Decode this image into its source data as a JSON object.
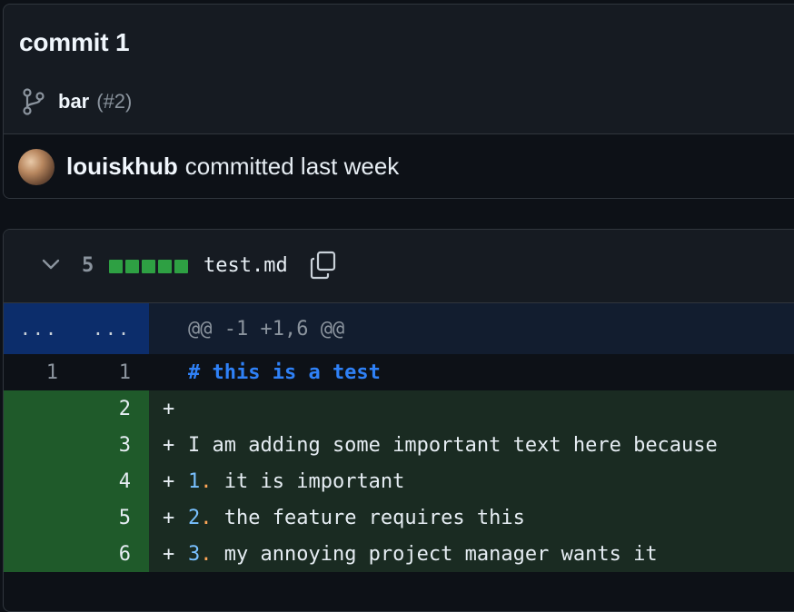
{
  "commit": {
    "title": "commit 1",
    "branch": "bar",
    "pr": "(#2)",
    "author": "louiskhub",
    "meta": "committed last week"
  },
  "file": {
    "changes": "5",
    "diffstat_additions": 5,
    "name": "test.md"
  },
  "diff": {
    "hunk": {
      "old": "...",
      "new": "...",
      "header": "@@ -1 +1,6 @@"
    },
    "context_line": {
      "old": "1",
      "new": "1",
      "text": "# this is a test"
    },
    "added": [
      {
        "new": "2",
        "sign": "+",
        "text": ""
      },
      {
        "new": "3",
        "sign": "+",
        "text": "I am adding some important text here because"
      },
      {
        "new": "4",
        "sign": "+",
        "num": "1",
        "dot": ".",
        "text": " it is important"
      },
      {
        "new": "5",
        "sign": "+",
        "num": "2",
        "dot": ".",
        "text": " the feature requires this"
      },
      {
        "new": "6",
        "sign": "+",
        "num": "3",
        "dot": ".",
        "text": " my annoying project manager wants it"
      }
    ]
  },
  "colors": {
    "background": "#0d1117",
    "addition": "#2ea043",
    "hunk_gutter": "#0c2d6b",
    "heading": "#2f81f7"
  },
  "icons": [
    "git-branch-icon",
    "chevron-down-icon",
    "copy-icon",
    "avatar"
  ]
}
